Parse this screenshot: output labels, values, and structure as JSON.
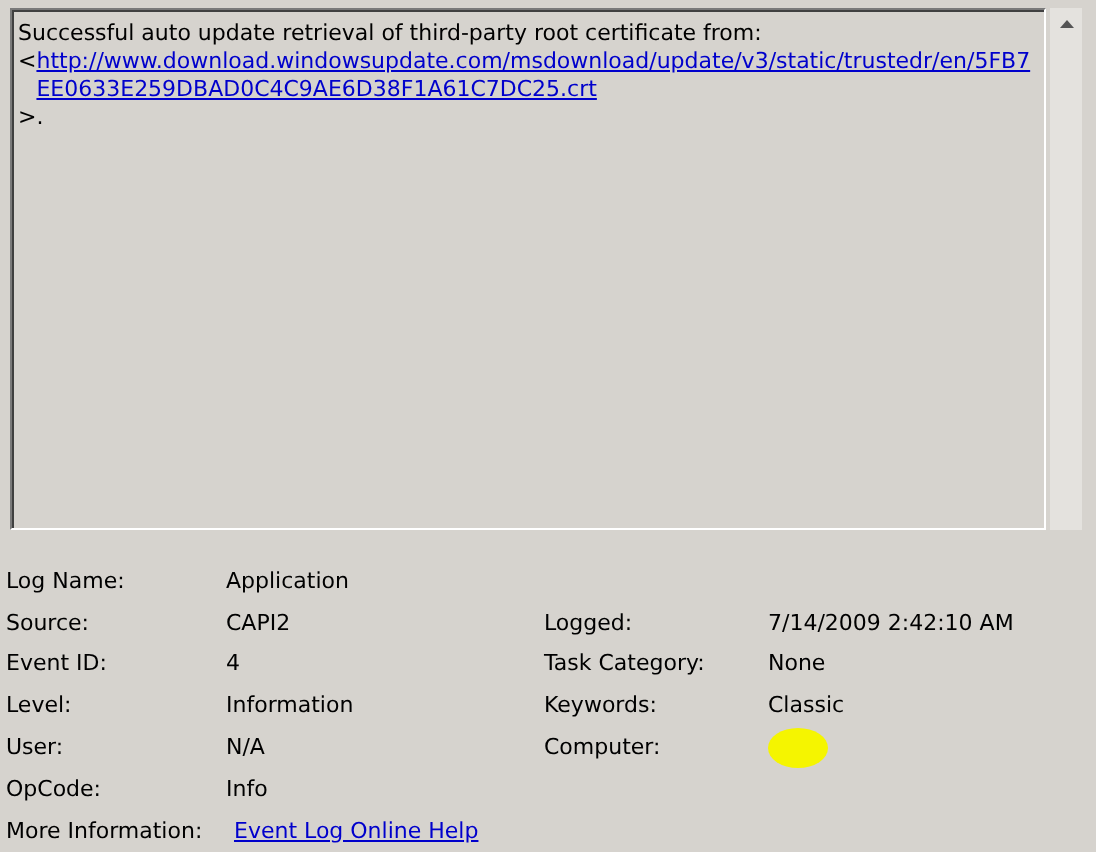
{
  "description": {
    "text": "Successful auto update retrieval of third-party root certificate from:",
    "prefix": "<",
    "link": "http://www.download.windowsupdate.com/msdownload/update/v3/static/trustedr/en/5FB7EE0633E259DBAD0C4C9AE6D38F1A61C7DC25.crt",
    "suffix": ">."
  },
  "rows": [
    {
      "left": {
        "label": "Log Name:",
        "value": "Application",
        "kind": "text"
      }
    },
    {
      "left": {
        "label": "Source:",
        "value": "CAPI2",
        "kind": "text"
      },
      "right": {
        "label": "Logged:",
        "value": "7/14/2009 2:42:10 AM",
        "kind": "text"
      }
    },
    {
      "left": {
        "label": "Event ID:",
        "value": "4",
        "kind": "text"
      },
      "right": {
        "label": "Task Category:",
        "value": "None",
        "kind": "text"
      }
    },
    {
      "left": {
        "label": "Level:",
        "value": "Information",
        "kind": "text"
      },
      "right": {
        "label": "Keywords:",
        "value": "Classic",
        "kind": "text"
      }
    },
    {
      "left": {
        "label": "User:",
        "value": "N/A",
        "kind": "text"
      },
      "right": {
        "label": "Computer:",
        "kind": "redacted"
      }
    },
    {
      "left": {
        "label": "OpCode:",
        "value": "Info",
        "kind": "text"
      }
    },
    {
      "left": {
        "label": "More Information:",
        "value": "Event Log Online Help",
        "kind": "link"
      }
    }
  ]
}
